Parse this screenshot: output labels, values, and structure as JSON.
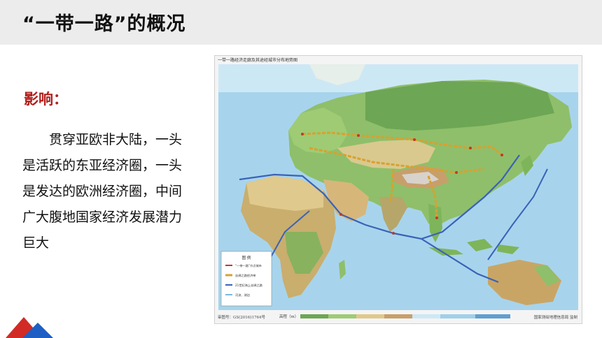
{
  "header": {
    "title": "“一带一路”的概况"
  },
  "content": {
    "heading": "影响：",
    "paragraph": "贯穿亚欧非大陆，一头是活跃的东亚经济圈，一头是发达的欧洲经济圈，中间广大腹地国家经济发展潜力巨大"
  },
  "map": {
    "caption": "一带一路经济走廊及其途经城市分布地势图",
    "legend": {
      "title": "图  例",
      "items": [
        "“一带一路”节点城市",
        "丝绸之路经济带",
        "21世纪海上丝绸之路",
        "河流、湖泊"
      ]
    },
    "footer_left": "审图号：GS(2016)1764号",
    "footer_right": "国家测绘地理信息局 监制",
    "scale_label": "高程（m）"
  },
  "colors": {
    "accent_red": "#b0201d",
    "land_route": "#d9a030",
    "sea_route": "#3a62b8",
    "ocean": "#9fd0ea",
    "deco_red": "#d22b25",
    "deco_blue": "#1f5fc4"
  }
}
